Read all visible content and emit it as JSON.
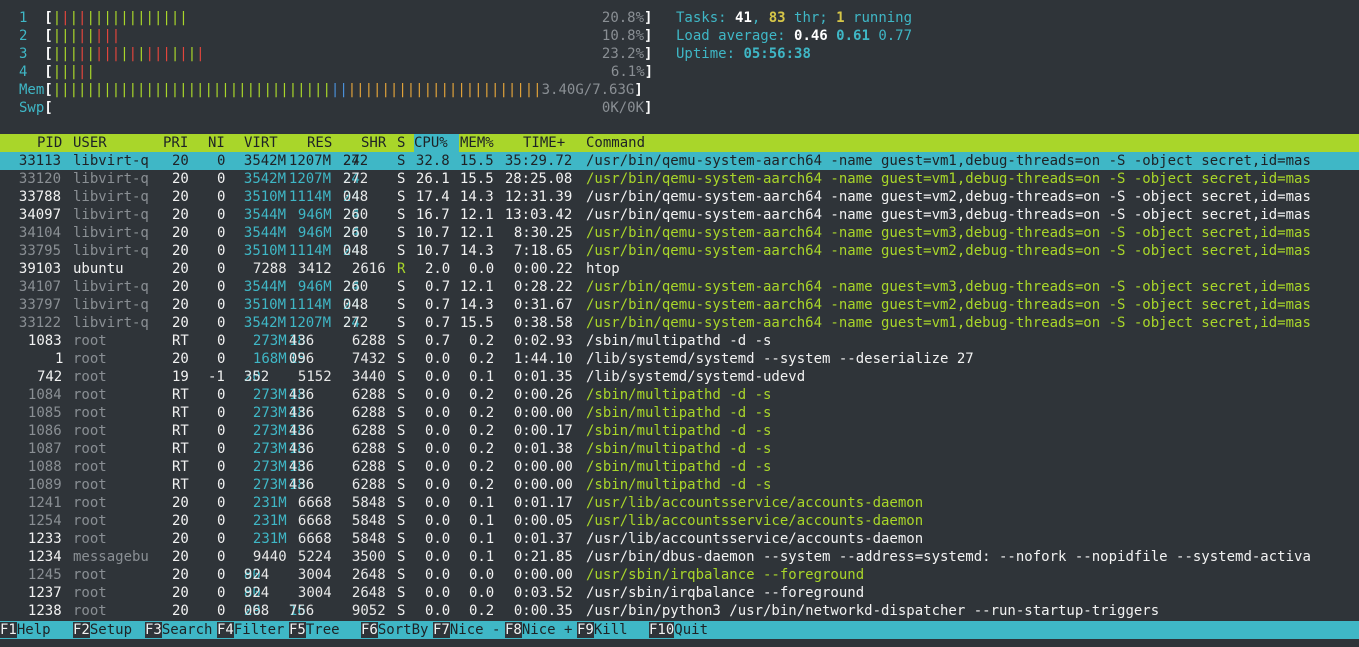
{
  "meters": {
    "cpus": [
      {
        "label": "1",
        "ticks": "||||||||||||||||",
        "value": "20.8%"
      },
      {
        "label": "2",
        "ticks": "||||||||",
        "value": "10.8%"
      },
      {
        "label": "3",
        "ticks": "||||||||||||||||||",
        "value": "23.2%"
      },
      {
        "label": "4",
        "ticks": "|||||",
        "value": "6.1%"
      }
    ],
    "mem": {
      "label": "Mem",
      "value": "3.40G/7.63G"
    },
    "swp": {
      "label": "Swp",
      "value": "0K/0K"
    }
  },
  "summary": {
    "tasks_label": "Tasks: ",
    "tasks": "41",
    "sep1": ", ",
    "threads": "83",
    "thr_label": " thr; ",
    "running": "1",
    "running_label": " running",
    "load_label": "Load average: ",
    "load1": "0.46",
    "load5": "0.61",
    "load15": "0.77",
    "uptime_label": "Uptime: ",
    "uptime": "05:56:38"
  },
  "columns": [
    "PID",
    "USER",
    "PRI",
    "NI",
    "VIRT",
    "RES",
    "SHR",
    "S",
    "CPU%",
    "MEM%",
    "TIME+",
    "Command"
  ],
  "processes": [
    {
      "pid": "33113",
      "user": "libvirt-q",
      "pri": "20",
      "ni": "0",
      "virt": "3542M",
      "res": "1207M",
      "shr": "24272",
      "s": "S",
      "cpu": "32.8",
      "mem": "15.5",
      "time": "35:29.72",
      "cmd": "/usr/bin/qemu-system-aarch64 -name guest=vm1,debug-threads=on -S -object secret,id=mas",
      "thread": true,
      "selected": true
    },
    {
      "pid": "33120",
      "user": "libvirt-q",
      "pri": "20",
      "ni": "0",
      "virt": "3542M",
      "res": "1207M",
      "shr": "24272",
      "s": "S",
      "cpu": "26.1",
      "mem": "15.5",
      "time": "28:25.08",
      "cmd": "/usr/bin/qemu-system-aarch64 -name guest=vm1,debug-threads=on -S -object secret,id=mas",
      "thread": true
    },
    {
      "pid": "33788",
      "user": "libvirt-q",
      "pri": "20",
      "ni": "0",
      "virt": "3510M",
      "res": "1114M",
      "shr": "24048",
      "s": "S",
      "cpu": "17.4",
      "mem": "14.3",
      "time": "12:31.39",
      "cmd": "/usr/bin/qemu-system-aarch64 -name guest=vm2,debug-threads=on -S -object secret,id=mas",
      "thread": false
    },
    {
      "pid": "34097",
      "user": "libvirt-q",
      "pri": "20",
      "ni": "0",
      "virt": "3544M",
      "res": "946M",
      "shr": "24260",
      "s": "S",
      "cpu": "16.7",
      "mem": "12.1",
      "time": "13:03.42",
      "cmd": "/usr/bin/qemu-system-aarch64 -name guest=vm3,debug-threads=on -S -object secret,id=mas",
      "thread": false
    },
    {
      "pid": "34104",
      "user": "libvirt-q",
      "pri": "20",
      "ni": "0",
      "virt": "3544M",
      "res": "946M",
      "shr": "24260",
      "s": "S",
      "cpu": "10.7",
      "mem": "12.1",
      "time": "8:30.25",
      "cmd": "/usr/bin/qemu-system-aarch64 -name guest=vm3,debug-threads=on -S -object secret,id=mas",
      "thread": true
    },
    {
      "pid": "33795",
      "user": "libvirt-q",
      "pri": "20",
      "ni": "0",
      "virt": "3510M",
      "res": "1114M",
      "shr": "24048",
      "s": "S",
      "cpu": "10.7",
      "mem": "14.3",
      "time": "7:18.65",
      "cmd": "/usr/bin/qemu-system-aarch64 -name guest=vm2,debug-threads=on -S -object secret,id=mas",
      "thread": true
    },
    {
      "pid": "39103",
      "user": "ubuntu",
      "pri": "20",
      "ni": "0",
      "virt": "7288",
      "res": "3412",
      "shr": "2616",
      "s": "R",
      "cpu": "2.0",
      "mem": "0.0",
      "time": "0:00.22",
      "cmd": "htop",
      "thread": false
    },
    {
      "pid": "34107",
      "user": "libvirt-q",
      "pri": "20",
      "ni": "0",
      "virt": "3544M",
      "res": "946M",
      "shr": "24260",
      "s": "S",
      "cpu": "0.7",
      "mem": "12.1",
      "time": "0:28.22",
      "cmd": "/usr/bin/qemu-system-aarch64 -name guest=vm3,debug-threads=on -S -object secret,id=mas",
      "thread": true
    },
    {
      "pid": "33797",
      "user": "libvirt-q",
      "pri": "20",
      "ni": "0",
      "virt": "3510M",
      "res": "1114M",
      "shr": "24048",
      "s": "S",
      "cpu": "0.7",
      "mem": "14.3",
      "time": "0:31.67",
      "cmd": "/usr/bin/qemu-system-aarch64 -name guest=vm2,debug-threads=on -S -object secret,id=mas",
      "thread": true
    },
    {
      "pid": "33122",
      "user": "libvirt-q",
      "pri": "20",
      "ni": "0",
      "virt": "3542M",
      "res": "1207M",
      "shr": "24272",
      "s": "S",
      "cpu": "0.7",
      "mem": "15.5",
      "time": "0:38.58",
      "cmd": "/usr/bin/qemu-system-aarch64 -name guest=vm1,debug-threads=on -S -object secret,id=mas",
      "thread": true
    },
    {
      "pid": "1083",
      "user": "root",
      "pri": "RT",
      "ni": "0",
      "virt": "273M",
      "res": "18436",
      "shr": "6288",
      "s": "S",
      "cpu": "0.7",
      "mem": "0.2",
      "time": "0:02.93",
      "cmd": "/sbin/multipathd -d -s",
      "thread": false
    },
    {
      "pid": "1",
      "user": "root",
      "pri": "20",
      "ni": "0",
      "virt": "168M",
      "res": "15096",
      "shr": "7432",
      "s": "S",
      "cpu": "0.0",
      "mem": "0.2",
      "time": "1:44.10",
      "cmd": "/lib/systemd/systemd --system --deserialize 27",
      "thread": false
    },
    {
      "pid": "742",
      "user": "root",
      "pri": "19",
      "ni": "-1",
      "virt": "20352",
      "res": "5152",
      "shr": "3440",
      "s": "S",
      "cpu": "0.0",
      "mem": "0.1",
      "time": "0:01.35",
      "cmd": "/lib/systemd/systemd-udevd",
      "thread": false
    },
    {
      "pid": "1084",
      "user": "root",
      "pri": "RT",
      "ni": "0",
      "virt": "273M",
      "res": "18436",
      "shr": "6288",
      "s": "S",
      "cpu": "0.0",
      "mem": "0.2",
      "time": "0:00.26",
      "cmd": "/sbin/multipathd -d -s",
      "thread": true
    },
    {
      "pid": "1085",
      "user": "root",
      "pri": "RT",
      "ni": "0",
      "virt": "273M",
      "res": "18436",
      "shr": "6288",
      "s": "S",
      "cpu": "0.0",
      "mem": "0.2",
      "time": "0:00.00",
      "cmd": "/sbin/multipathd -d -s",
      "thread": true
    },
    {
      "pid": "1086",
      "user": "root",
      "pri": "RT",
      "ni": "0",
      "virt": "273M",
      "res": "18436",
      "shr": "6288",
      "s": "S",
      "cpu": "0.0",
      "mem": "0.2",
      "time": "0:00.17",
      "cmd": "/sbin/multipathd -d -s",
      "thread": true
    },
    {
      "pid": "1087",
      "user": "root",
      "pri": "RT",
      "ni": "0",
      "virt": "273M",
      "res": "18436",
      "shr": "6288",
      "s": "S",
      "cpu": "0.0",
      "mem": "0.2",
      "time": "0:01.38",
      "cmd": "/sbin/multipathd -d -s",
      "thread": true
    },
    {
      "pid": "1088",
      "user": "root",
      "pri": "RT",
      "ni": "0",
      "virt": "273M",
      "res": "18436",
      "shr": "6288",
      "s": "S",
      "cpu": "0.0",
      "mem": "0.2",
      "time": "0:00.00",
      "cmd": "/sbin/multipathd -d -s",
      "thread": true
    },
    {
      "pid": "1089",
      "user": "root",
      "pri": "RT",
      "ni": "0",
      "virt": "273M",
      "res": "18436",
      "shr": "6288",
      "s": "S",
      "cpu": "0.0",
      "mem": "0.2",
      "time": "0:00.00",
      "cmd": "/sbin/multipathd -d -s",
      "thread": true
    },
    {
      "pid": "1241",
      "user": "root",
      "pri": "20",
      "ni": "0",
      "virt": "231M",
      "res": "6668",
      "shr": "5848",
      "s": "S",
      "cpu": "0.0",
      "mem": "0.1",
      "time": "0:01.17",
      "cmd": "/usr/lib/accountsservice/accounts-daemon",
      "thread": true
    },
    {
      "pid": "1254",
      "user": "root",
      "pri": "20",
      "ni": "0",
      "virt": "231M",
      "res": "6668",
      "shr": "5848",
      "s": "S",
      "cpu": "0.0",
      "mem": "0.1",
      "time": "0:00.05",
      "cmd": "/usr/lib/accountsservice/accounts-daemon",
      "thread": true
    },
    {
      "pid": "1233",
      "user": "root",
      "pri": "20",
      "ni": "0",
      "virt": "231M",
      "res": "6668",
      "shr": "5848",
      "s": "S",
      "cpu": "0.0",
      "mem": "0.1",
      "time": "0:01.37",
      "cmd": "/usr/lib/accountsservice/accounts-daemon",
      "thread": false
    },
    {
      "pid": "1234",
      "user": "messagebu",
      "pri": "20",
      "ni": "0",
      "virt": "9440",
      "res": "5224",
      "shr": "3500",
      "s": "S",
      "cpu": "0.0",
      "mem": "0.1",
      "time": "0:21.85",
      "cmd": "/usr/bin/dbus-daemon --system --address=systemd: --nofork --nopidfile --systemd-activa",
      "thread": false
    },
    {
      "pid": "1245",
      "user": "root",
      "pri": "20",
      "ni": "0",
      "virt": "80924",
      "res": "3004",
      "shr": "2648",
      "s": "S",
      "cpu": "0.0",
      "mem": "0.0",
      "time": "0:00.00",
      "cmd": "/usr/sbin/irqbalance --foreground",
      "thread": true
    },
    {
      "pid": "1237",
      "user": "root",
      "pri": "20",
      "ni": "0",
      "virt": "80924",
      "res": "3004",
      "shr": "2648",
      "s": "S",
      "cpu": "0.0",
      "mem": "0.0",
      "time": "0:03.52",
      "cmd": "/usr/sbin/irqbalance --foreground",
      "thread": false
    },
    {
      "pid": "1238",
      "user": "root",
      "pri": "20",
      "ni": "0",
      "virt": "29068",
      "res": "16756",
      "shr": "9052",
      "s": "S",
      "cpu": "0.0",
      "mem": "0.2",
      "time": "0:00.35",
      "cmd": "/usr/bin/python3 /usr/bin/networkd-dispatcher --run-startup-triggers",
      "thread": false
    }
  ],
  "footer": [
    {
      "key": "F1",
      "label": "Help  "
    },
    {
      "key": "F2",
      "label": "Setup "
    },
    {
      "key": "F3",
      "label": "Search"
    },
    {
      "key": "F4",
      "label": "Filter"
    },
    {
      "key": "F5",
      "label": "Tree  "
    },
    {
      "key": "F6",
      "label": "SortBy"
    },
    {
      "key": "F7",
      "label": "Nice -"
    },
    {
      "key": "F8",
      "label": "Nice +"
    },
    {
      "key": "F9",
      "label": "Kill  "
    },
    {
      "key": "F10",
      "label": "Quit"
    }
  ],
  "colors": {
    "background": "#2f3439",
    "header": "#a9d62a",
    "selection": "#3fb7c6"
  }
}
